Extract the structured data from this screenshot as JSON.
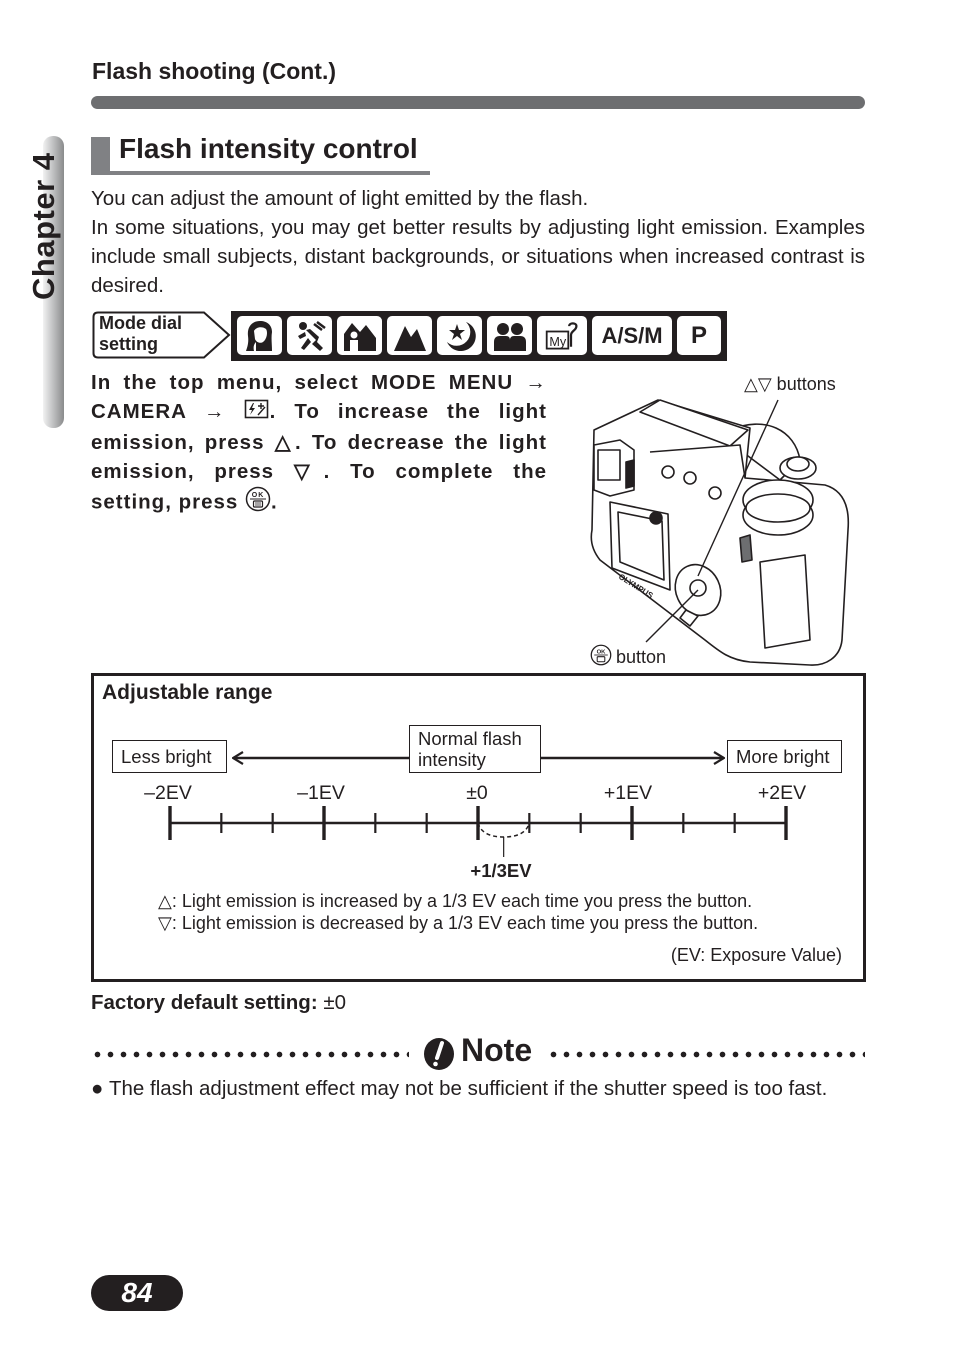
{
  "header": {
    "section_title": "Flash shooting (Cont.)",
    "chapter_tab": "Chapter 4"
  },
  "title": "Flash intensity control",
  "intro": {
    "line1": "You can adjust the amount of light emitted by the flash.",
    "line2": "In some situations, you may get better results by adjusting light emission. Examples include small subjects, distant backgrounds, or situations when increased contrast is desired."
  },
  "mode_dial": {
    "label_line1": "Mode dial",
    "label_line2": "setting",
    "icons": [
      {
        "name": "portrait-mode-icon"
      },
      {
        "name": "sports-mode-icon"
      },
      {
        "name": "landscape-portrait-mode-icon"
      },
      {
        "name": "landscape-mode-icon"
      },
      {
        "name": "night-scene-mode-icon"
      },
      {
        "name": "self-portrait-mode-icon"
      },
      {
        "name": "my-mode-icon"
      },
      {
        "name": "asm-mode",
        "text": "A/S/M"
      },
      {
        "name": "program-mode",
        "text": "P"
      }
    ]
  },
  "steps": {
    "part1": "In the top menu, select MODE MENU → CAMERA → ",
    "part2": ". To increase the light emission, press △. To decrease the light emission, press ▽. To complete the setting, press ",
    "part3": "."
  },
  "camera_figure": {
    "updown_label": "△▽ buttons",
    "ok_label": "button",
    "brand": "OLYMPUS"
  },
  "range": {
    "title": "Adjustable range",
    "less": "Less bright",
    "normal_line1": "Normal flash",
    "normal_line2": "intensity",
    "more": "More bright",
    "ev_labels": [
      "–2EV",
      "–1EV",
      "±0",
      "+1EV",
      "+2EV"
    ],
    "step_label": "+1/3EV",
    "note_up": "△: Light emission is increased by a 1/3 EV each time you press the button.",
    "note_down": "▽: Light emission is decreased by a 1/3 EV each time you press the button.",
    "ev_definition": "(EV: Exposure Value)"
  },
  "chart_data": {
    "type": "scale",
    "title": "Adjustable range",
    "min": -2,
    "max": 2,
    "step": 0.3333,
    "unit": "EV",
    "major_ticks": [
      -2,
      -1,
      0,
      1,
      2
    ],
    "tick_labels": [
      "–2EV",
      "–1EV",
      "±0",
      "+1EV",
      "+2EV"
    ],
    "minor_ticks": [
      -1.6667,
      -1.3333,
      -0.6667,
      -0.3333,
      0.3333,
      0.6667,
      1.3333,
      1.6667
    ],
    "annotation": {
      "from": 0,
      "to": 0.3333,
      "label": "+1/3EV"
    },
    "left_label": "Less bright",
    "center_label": "Normal flash intensity",
    "right_label": "More bright"
  },
  "factory_default": {
    "label": "Factory default setting:",
    "value": "±0"
  },
  "note": {
    "title": "Note",
    "bullet": "The flash adjustment effect may not be sufficient if the shutter speed is too fast."
  },
  "page_number": "84"
}
